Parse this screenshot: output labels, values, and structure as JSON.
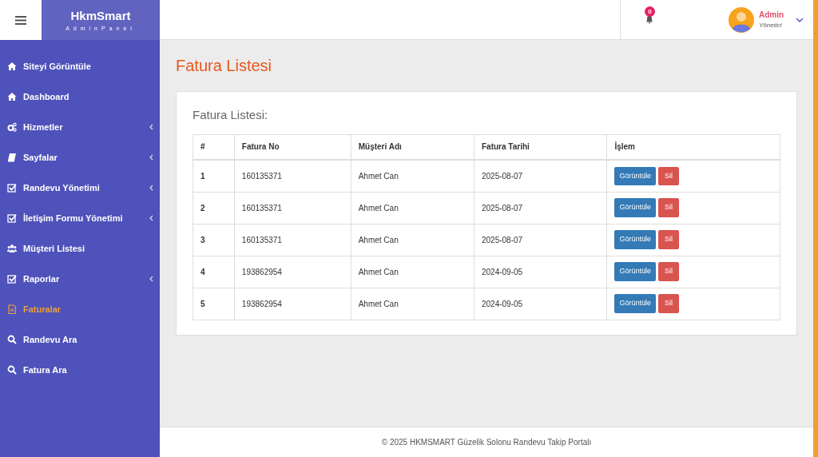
{
  "brand": {
    "title": "HkmSmart",
    "subtitle": "AdminPanel"
  },
  "header": {
    "notification_count": "0",
    "user": {
      "name": "Admin",
      "role": "Yönetici"
    }
  },
  "sidebar": {
    "items": [
      {
        "label": "Siteyi Görüntüle",
        "kind": "home",
        "has_submenu": false,
        "selected": false
      },
      {
        "label": "Dashboard",
        "kind": "home",
        "has_submenu": false,
        "selected": false
      },
      {
        "label": "Hizmetler",
        "kind": "gears",
        "has_submenu": true,
        "selected": false
      },
      {
        "label": "Sayfalar",
        "kind": "book",
        "has_submenu": true,
        "selected": false
      },
      {
        "label": "Randevu Yönetimi",
        "kind": "check",
        "has_submenu": true,
        "selected": false
      },
      {
        "label": "İletişim Formu Yönetimi",
        "kind": "check",
        "has_submenu": true,
        "selected": false
      },
      {
        "label": "Müşteri Listesi",
        "kind": "users",
        "has_submenu": false,
        "selected": false
      },
      {
        "label": "Raporlar",
        "kind": "check",
        "has_submenu": true,
        "selected": false
      },
      {
        "label": "Faturalar",
        "kind": "file",
        "has_submenu": false,
        "selected": true
      },
      {
        "label": "Randevu Ara",
        "kind": "search",
        "has_submenu": false,
        "selected": false
      },
      {
        "label": "Fatura Ara",
        "kind": "search",
        "has_submenu": false,
        "selected": false
      }
    ]
  },
  "page_title": "Fatura Listesi",
  "card": {
    "title": "Fatura Listesi:",
    "table": {
      "columns": [
        "#",
        "Fatura No",
        "Müşteri Adı",
        "Fatura Tarihi",
        "İşlem"
      ],
      "rows": [
        {
          "cells": [
            "1",
            "160135371",
            "Ahmet Can",
            "2025-08-07"
          ],
          "actions": [
            "Görüntüle",
            "Sil"
          ]
        },
        {
          "cells": [
            "2",
            "160135371",
            "Ahmet Can",
            "2025-08-07"
          ],
          "actions": [
            "Görüntüle",
            "Sil"
          ]
        },
        {
          "cells": [
            "3",
            "160135371",
            "Ahmet Can",
            "2025-08-07"
          ],
          "actions": [
            "Görüntüle",
            "Sil"
          ]
        },
        {
          "cells": [
            "4",
            "193862954",
            "Ahmet Can",
            "2024-09-05"
          ],
          "actions": [
            "Görüntüle",
            "Sil"
          ]
        },
        {
          "cells": [
            "5",
            "193862954",
            "Ahmet Can",
            "2024-09-05"
          ],
          "actions": [
            "Görüntüle",
            "Sil"
          ]
        }
      ]
    }
  },
  "footer": "© 2025 HKMSMART Güzelik Solonu Randevu Takip Portalı"
}
